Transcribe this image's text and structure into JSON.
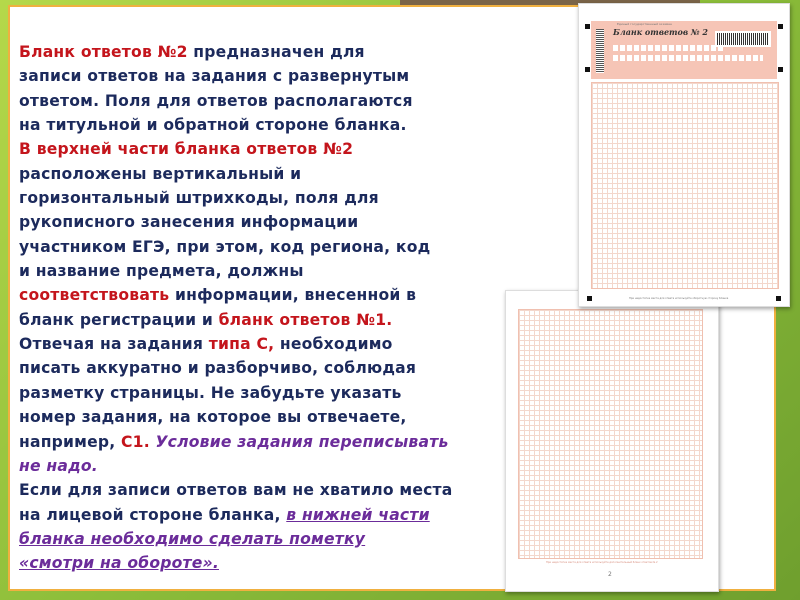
{
  "slide": {
    "lines": [
      [
        {
          "t": "Бланк ответов №2",
          "c": "red"
        },
        {
          "t": " предназначен для",
          "c": "n"
        }
      ],
      [
        {
          "t": "записи ответов на задания с развернутым",
          "c": "n"
        }
      ],
      [
        {
          "t": "ответом. Поля для ответов располагаются",
          "c": "n"
        }
      ],
      [
        {
          "t": "на титульной и обратной стороне бланка.",
          "c": "n"
        }
      ],
      [
        {
          "t": " В верхней части бланка ответов №2",
          "c": "red"
        }
      ],
      [
        {
          "t": "расположены вертикальный и",
          "c": "n"
        }
      ],
      [
        {
          "t": "горизонтальный штрихкоды, поля для",
          "c": "n"
        }
      ],
      [
        {
          "t": "рукописного занесения информации",
          "c": "n"
        }
      ],
      [
        {
          "t": "участником ЕГЭ, при этом, код региона, код",
          "c": "n"
        }
      ],
      [
        {
          "t": "и название предмета, должны",
          "c": "n"
        }
      ],
      [
        {
          "t": "соответствовать",
          "c": "red"
        },
        {
          "t": " информации, внесенной в",
          "c": "n"
        }
      ],
      [
        {
          "t": " бланк регистрации и ",
          "c": "n"
        },
        {
          "t": "бланк ответов №1.",
          "c": "red"
        }
      ],
      [
        {
          "t": "Отвечая на задания ",
          "c": "n"
        },
        {
          "t": "типа С,",
          "c": "red"
        },
        {
          "t": " необходимо",
          "c": "n"
        }
      ],
      [
        {
          "t": "писать аккуратно и разборчиво, соблюдая",
          "c": "n"
        }
      ],
      [
        {
          "t": "разметку страницы. Не забудьте указать",
          "c": "n"
        }
      ],
      [
        {
          "t": " номер задания, на которое вы отвечаете,",
          "c": "n"
        }
      ],
      [
        {
          "t": "например, ",
          "c": "n"
        },
        {
          "t": "С1.",
          "c": "red"
        },
        {
          "t": " Условие задания переписывать",
          "c": "purple"
        }
      ],
      [
        {
          "t": " не надо.",
          "c": "purple"
        }
      ],
      [
        {
          "t": "Если для записи ответов вам не хватило места",
          "c": "n"
        }
      ],
      [
        {
          "t": "на лицевой стороне бланка, ",
          "c": "n"
        },
        {
          "t": "в нижней части",
          "c": "link"
        }
      ],
      [
        {
          "t": "бланка необходимо сделать пометку",
          "c": "link"
        }
      ],
      [
        {
          "t": "«смотри на обороте».",
          "c": "link"
        }
      ]
    ]
  },
  "form_front": {
    "header": "Единый государственный экзамен",
    "title": "Бланк ответов № 2",
    "footer": "При недостатке места для ответа используйте оборотную сторону бланка"
  },
  "form_back": {
    "footer": "При недостатке места для ответа используйте дополнительный бланк ответов № 2",
    "page_number": "2"
  },
  "colors": {
    "text": "#1c2a5c",
    "red": "#c4151c",
    "purple": "#6b2c9a",
    "border": "#f0b040"
  }
}
